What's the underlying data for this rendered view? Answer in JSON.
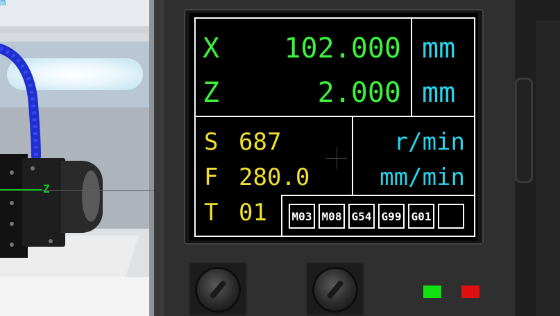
{
  "scene": {
    "top_label": "m",
    "axis_label": "Z"
  },
  "display": {
    "x_axis": "X",
    "x_value": "102.000",
    "x_unit": "mm",
    "z_axis": "Z",
    "z_value": "2.000",
    "z_unit": "mm",
    "s_label": "S",
    "s_value": "687",
    "s_unit": "r/min",
    "f_label": "F",
    "f_value": "280.0",
    "f_unit": "mm/min",
    "t_label": "T",
    "t_value": "01",
    "codes": [
      "M03",
      "M08",
      "G54",
      "G99",
      "G01",
      ""
    ]
  },
  "indicators": {
    "green_led": "#10e010",
    "red_led": "#e01010"
  },
  "colors": {
    "position_text": "#3cf23c",
    "unit_text": "#27d6ee",
    "spindle_text": "#f0e130"
  }
}
